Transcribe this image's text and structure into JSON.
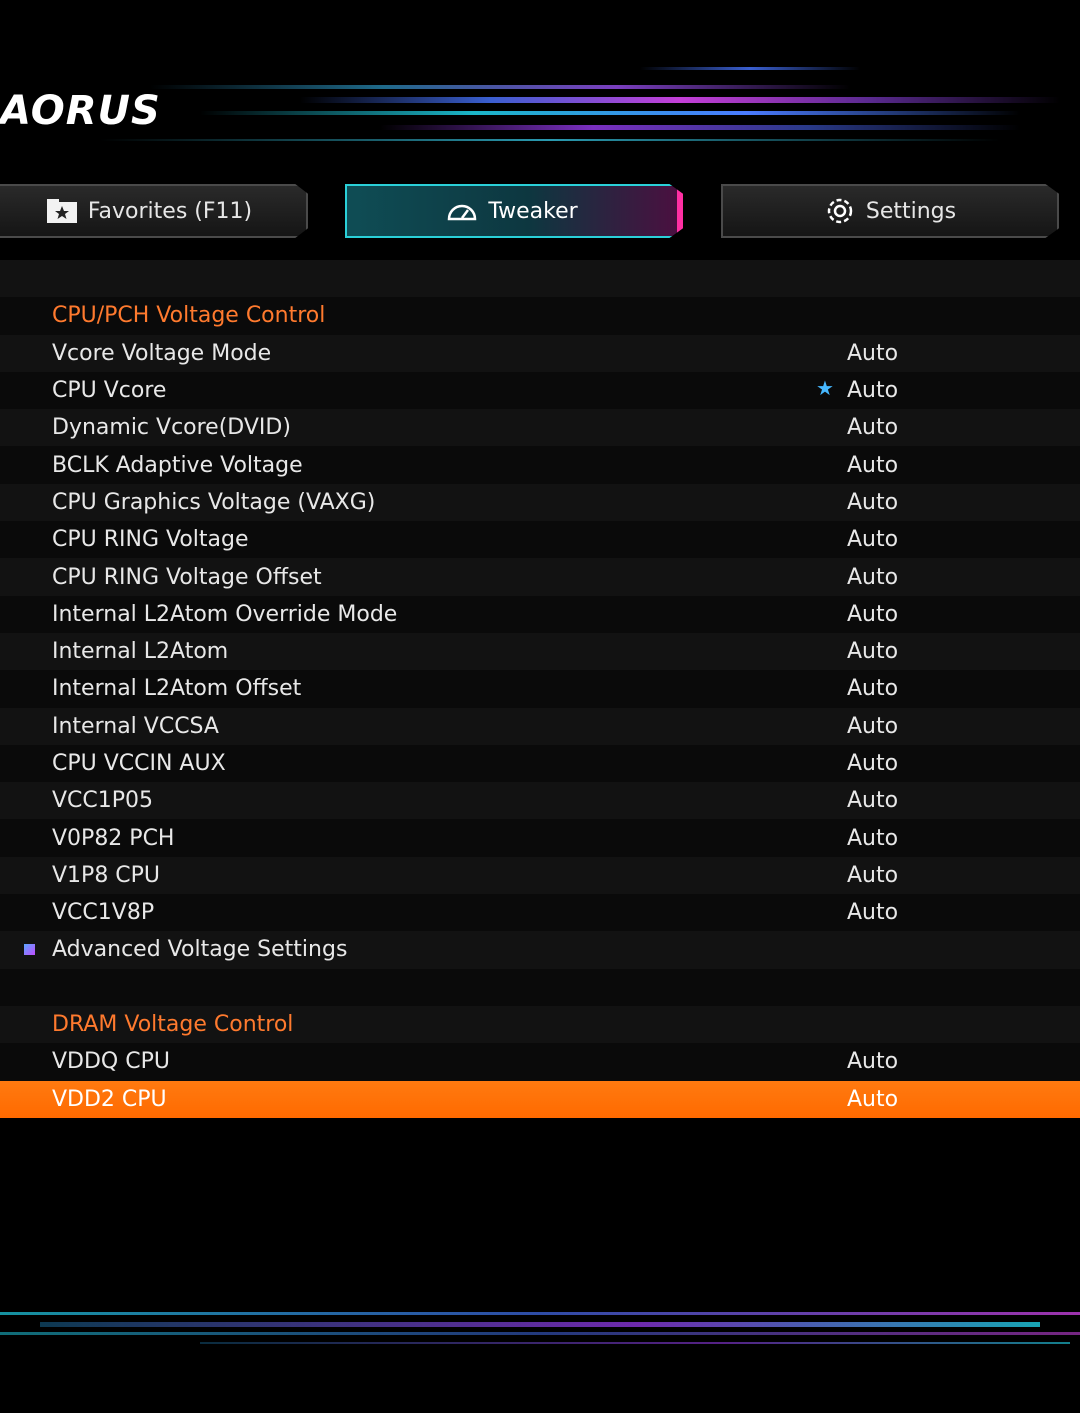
{
  "brand": {
    "logo_text": "AORUS"
  },
  "tabs": [
    {
      "label": "Favorites (F11)",
      "icon": "star-folder-icon"
    },
    {
      "label": "Tweaker",
      "icon": "speedometer-icon",
      "active": true
    },
    {
      "label": "Settings",
      "icon": "gear-icon"
    }
  ],
  "rows": [
    {
      "type": "blank"
    },
    {
      "type": "section",
      "label": "CPU/PCH Voltage Control"
    },
    {
      "label": "Vcore Voltage Mode",
      "value": "Auto"
    },
    {
      "label": "CPU Vcore",
      "value": "Auto",
      "favorite": true
    },
    {
      "label": "Dynamic Vcore(DVID)",
      "value": "Auto"
    },
    {
      "label": "BCLK Adaptive Voltage",
      "value": "Auto"
    },
    {
      "label": "CPU Graphics Voltage (VAXG)",
      "value": "Auto"
    },
    {
      "label": "CPU RING Voltage",
      "value": "Auto"
    },
    {
      "label": "CPU RING Voltage Offset",
      "value": "Auto"
    },
    {
      "label": "Internal L2Atom Override Mode",
      "value": "Auto"
    },
    {
      "label": "Internal L2Atom",
      "value": "Auto"
    },
    {
      "label": "Internal L2Atom Offset",
      "value": "Auto"
    },
    {
      "label": "Internal VCCSA",
      "value": "Auto"
    },
    {
      "label": "CPU VCCIN AUX",
      "value": "Auto"
    },
    {
      "label": "VCC1P05",
      "value": "Auto"
    },
    {
      "label": "V0P82 PCH",
      "value": "Auto"
    },
    {
      "label": "V1P8 CPU",
      "value": "Auto"
    },
    {
      "label": "VCC1V8P",
      "value": "Auto"
    },
    {
      "type": "submenu",
      "label": "Advanced Voltage Settings"
    },
    {
      "type": "blank"
    },
    {
      "type": "section",
      "label": "DRAM Voltage Control"
    },
    {
      "label": "VDDQ CPU",
      "value": "Auto"
    },
    {
      "label": "VDD2 CPU",
      "value": "Auto",
      "selected": true
    }
  ],
  "colors": {
    "accent_orange": "#ff6a00",
    "section_header": "#ff7a2e",
    "tab_active_border": "#2ad0d8",
    "tab_active_edge": "#ff2fa3"
  }
}
